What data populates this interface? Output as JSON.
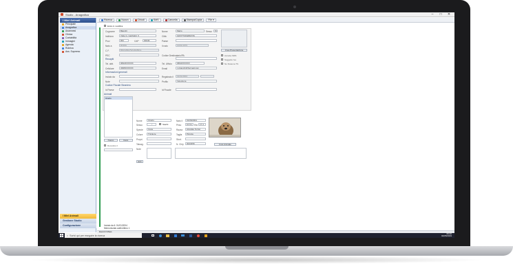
{
  "window": {
    "title": "Studio - Anagrafica"
  },
  "sidebar": {
    "header": "I Miei Animali",
    "items": [
      {
        "label": "Principale",
        "color": "#e3a21a"
      },
      {
        "label": "Anagrafica",
        "color": "#3b7dd8"
      },
      {
        "label": "Anamnesi",
        "color": "#2e9b4f"
      },
      {
        "label": "Clinica",
        "color": "#d04b2a"
      },
      {
        "label": "Contabilità",
        "color": "#7a5bb5"
      },
      {
        "label": "Immagini",
        "color": "#1a9fb0"
      },
      {
        "label": "Agenda",
        "color": "#e3a21a"
      },
      {
        "label": "Rubrica",
        "color": "#3b7dd8"
      },
      {
        "label": "Ass. Supremo",
        "color": "#d04b2a"
      }
    ],
    "bottom": [
      "I Miei Animali",
      "Gestione Studio",
      "Configurazione"
    ]
  },
  "toolbar": {
    "buttons": [
      "Ricerca",
      "Nuovo",
      "Chiudi",
      "SMS",
      "Cancella",
      "Stampa/Copia",
      "File"
    ]
  },
  "form": {
    "check_enable_edit": "Entra in modifica",
    "owner": {
      "cognome_label": "Cognome",
      "cognome": "Bianchi",
      "nome_label": "Nome",
      "nome": "Mario",
      "sesso_label": "Sesso",
      "sesso": "M",
      "indirizzo_label": "Indirizzo",
      "indirizzo": "Viale G. Garibaldi, 6",
      "citta_label": "Città",
      "citta": "GROTTAFERRATA",
      "prov_label": "Prov",
      "prov": "RM",
      "cap_label": "CAP",
      "cap": "00046",
      "paese_label": "Paese",
      "paese": "",
      "nato_label": "Nato a",
      "nato": "ROMA",
      "il_label": "Il nato",
      "il": "10/01/1979",
      "cf_label": "C.F.",
      "cf": "BNCMRA79A10H501L",
      "pec_label": "PEC",
      "pec": "",
      "codice_label": "Codice Destinatario/PA",
      "codice": ""
    },
    "recapiti_title": "Recapiti",
    "recapiti": {
      "tel_label": "Tel. abit.",
      "tel": "0694XXXXXX",
      "tel_uff_label": "Tel. Ufficio",
      "tel_uff": "0694XXXXXX",
      "cell_label": "Cellulare",
      "cell": "3395XXXXXX",
      "email_label": "Email",
      "email": "m.bianchi@hotmail.com"
    },
    "info_title": "Informazioni generali",
    "info": {
      "inviato_label": "Inviato da",
      "inviato": "",
      "registrato_label": "Registrato il",
      "registrato": "01/01/2004",
      "note_label": "Note",
      "note": "",
      "profilo_label": "Profilo",
      "profilo": "Ingegnere"
    },
    "fiscal_title": "Codice Fiscale Straniero",
    "fiscal": {
      "paese_label": "Id Paese",
      "paese": "",
      "fiscale_label": "Id Fiscale",
      "fiscale": ""
    },
    "side": {
      "photo_button": "Crea Presentazione",
      "chk1": "Accetta SMS",
      "chk2": "Soggetto Iva",
      "chk3": "No Sistema TS"
    }
  },
  "animals": {
    "title": "Animali",
    "list": [
      "Orazio"
    ],
    "btn_new": "Nuovo",
    "btn_cancel": "Canc.",
    "deceased": "Deceduto il",
    "nome_label": "Nome",
    "nome": "Orazio",
    "sesso_label": "Sesso",
    "sterile": "Sterilz.",
    "specie_label": "Specie",
    "specie": "Cane",
    "colore_label": "Colore",
    "colore": "Tricolore",
    "propri_label": "Propri.",
    "propri": "",
    "tatuag_label": "Tatuag.",
    "tatuag": "",
    "note_label": "Note",
    "note": "",
    "nato_label": "Nato il",
    "nato": "01/06/2001",
    "peso_label": "Peso",
    "peso": "10 Kg",
    "eta_label": "Età",
    "eta": "17,4",
    "razza_label": "Razza",
    "razza": "Airedale Terrier",
    "taglia_label": "Taglia",
    "taglia": "Piccola",
    "stort_label": "Stort.",
    "stort": "",
    "chip_label": "N. Chip",
    "chip": "0023456",
    "photo_button": "Foto Animale",
    "edit_btn": "Edit"
  },
  "status": {
    "line1": "Inviato da il: 01/01/2004",
    "line2": "Memorizzato auth/ultimo 1"
  },
  "statusbar": {
    "text": "Esercizi Mass"
  },
  "taskbar": {
    "search_placeholder": "Scrivi qui per eseguire la ricerca",
    "time": "09:40",
    "date": "02/05/2019"
  }
}
